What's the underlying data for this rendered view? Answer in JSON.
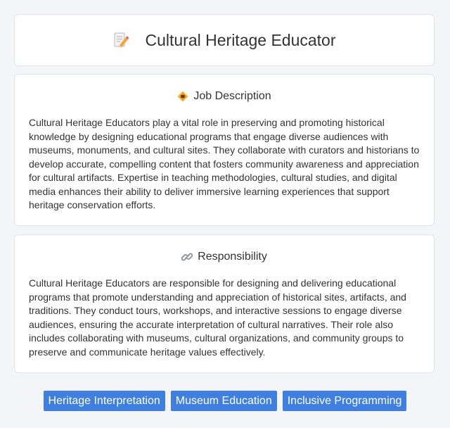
{
  "header": {
    "title": "Cultural Heritage Educator",
    "icon": "memo-pencil-icon"
  },
  "sections": {
    "description": {
      "heading": "Job Description",
      "icon": "diamond-badge-icon",
      "body": "Cultural Heritage Educators play a vital role in preserving and promoting historical knowledge by designing educational programs that engage diverse audiences with museums, monuments, and cultural sites. They collaborate with curators and historians to develop accurate, compelling content that fosters community awareness and appreciation for cultural artifacts. Expertise in teaching methodologies, cultural studies, and digital media enhances their ability to deliver immersive learning experiences that support heritage conservation efforts."
    },
    "responsibility": {
      "heading": "Responsibility",
      "icon": "link-icon",
      "body": "Cultural Heritage Educators are responsible for designing and delivering educational programs that promote understanding and appreciation of historical sites, artifacts, and traditions. They conduct tours, workshops, and interactive sessions to engage diverse audiences, ensuring the accurate interpretation of cultural narratives. Their role also includes collaborating with museums, cultural organizations, and community groups to preserve and communicate heritage values effectively."
    }
  },
  "tags": [
    "Heritage Interpretation",
    "Museum Education",
    "Inclusive Programming"
  ],
  "colors": {
    "tag_background": "#3f7fe0",
    "page_background": "#f4f5f8"
  }
}
